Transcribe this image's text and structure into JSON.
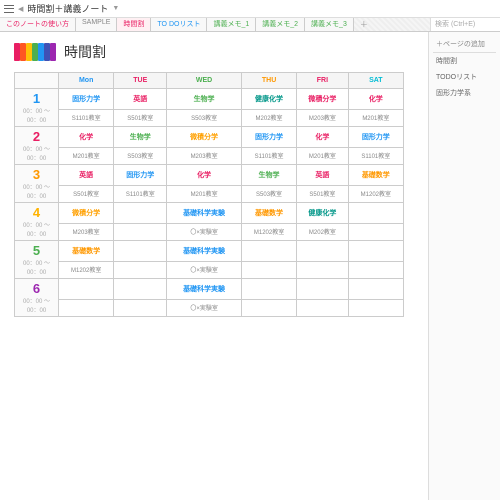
{
  "notebook_title": "時間割＋講義ノート",
  "tabs": [
    "このノートの使い方",
    "SAMPLE",
    "時間割",
    "TO DOリスト",
    "講義メモ_1",
    "講義メモ_2",
    "講義メモ_3"
  ],
  "search_placeholder": "検索 (Ctrl+E)",
  "sidebar": {
    "add": "＋ページの追加",
    "items": [
      "時間割",
      "TODOリスト",
      "固形力学系"
    ]
  },
  "page_title": "時間割",
  "logo_colors": [
    "#e91e63",
    "#ff5722",
    "#ffc107",
    "#4caf50",
    "#2196f3",
    "#3f51b5",
    "#9c27b0"
  ],
  "days": [
    "Mon",
    "TUE",
    "WED",
    "THU",
    "FRI",
    "SAT"
  ],
  "time_label": "00：00 ～ 00：00",
  "periods": [
    {
      "n": "1",
      "cells": [
        {
          "s": "固形力学",
          "r": "S1101教室",
          "c": "c-blue"
        },
        {
          "s": "英語",
          "r": "S501教室",
          "c": "c-red"
        },
        {
          "s": "生物学",
          "r": "S503教室",
          "c": "c-green"
        },
        {
          "s": "健康化学",
          "r": "M202教室",
          "c": "c-teal"
        },
        {
          "s": "微積分学",
          "r": "M203教室",
          "c": "c-pink"
        },
        {
          "s": "化学",
          "r": "M201教室",
          "c": "c-red"
        }
      ]
    },
    {
      "n": "2",
      "cells": [
        {
          "s": "化学",
          "r": "M201教室",
          "c": "c-red"
        },
        {
          "s": "生物学",
          "r": "S503教室",
          "c": "c-green"
        },
        {
          "s": "微積分学",
          "r": "M203教室",
          "c": "c-amber"
        },
        {
          "s": "固形力学",
          "r": "S1101教室",
          "c": "c-blue"
        },
        {
          "s": "化学",
          "r": "M201教室",
          "c": "c-red"
        },
        {
          "s": "固形力学",
          "r": "S1101教室",
          "c": "c-blue"
        }
      ]
    },
    {
      "n": "3",
      "cells": [
        {
          "s": "英語",
          "r": "S501教室",
          "c": "c-red"
        },
        {
          "s": "固形力学",
          "r": "S1101教室",
          "c": "c-blue"
        },
        {
          "s": "化学",
          "r": "M201教室",
          "c": "c-red"
        },
        {
          "s": "生物学",
          "r": "S503教室",
          "c": "c-green"
        },
        {
          "s": "英語",
          "r": "S501教室",
          "c": "c-red"
        },
        {
          "s": "基礎数学",
          "r": "M1202教室",
          "c": "c-orange"
        }
      ]
    },
    {
      "n": "4",
      "cells": [
        {
          "s": "微積分学",
          "r": "M203教室",
          "c": "c-amber"
        },
        {
          "s": "",
          "r": "",
          "c": ""
        },
        {
          "s": "基礎科学実験",
          "r": "〇×実験室",
          "c": "c-blue"
        },
        {
          "s": "基礎数学",
          "r": "M1202教室",
          "c": "c-orange"
        },
        {
          "s": "健康化学",
          "r": "M202教室",
          "c": "c-teal"
        },
        {
          "s": "",
          "r": "",
          "c": ""
        }
      ]
    },
    {
      "n": "5",
      "cells": [
        {
          "s": "基礎数学",
          "r": "M1202教室",
          "c": "c-orange"
        },
        {
          "s": "",
          "r": "",
          "c": ""
        },
        {
          "s": "基礎科学実験",
          "r": "〇×実験室",
          "c": "c-blue"
        },
        {
          "s": "",
          "r": "",
          "c": ""
        },
        {
          "s": "",
          "r": "",
          "c": ""
        },
        {
          "s": "",
          "r": "",
          "c": ""
        }
      ]
    },
    {
      "n": "6",
      "cells": [
        {
          "s": "",
          "r": "",
          "c": ""
        },
        {
          "s": "",
          "r": "",
          "c": ""
        },
        {
          "s": "基礎科学実験",
          "r": "〇×実験室",
          "c": "c-blue"
        },
        {
          "s": "",
          "r": "",
          "c": ""
        },
        {
          "s": "",
          "r": "",
          "c": ""
        },
        {
          "s": "",
          "r": "",
          "c": ""
        }
      ]
    }
  ]
}
